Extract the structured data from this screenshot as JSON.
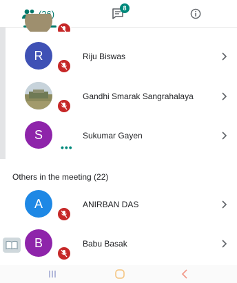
{
  "tabs": {
    "people_count": "(26)",
    "chat_badge": "8"
  },
  "participants": [
    {
      "name": "Riju Biswas",
      "initial": "R",
      "avatar_color": "#3f51b5"
    },
    {
      "name": "Gandhi Smarak Sangrahalaya"
    },
    {
      "name": "Sukumar Gayen",
      "initial": "S",
      "avatar_color": "#8e24aa"
    }
  ],
  "others_section": {
    "label": "Others in the meeting (22)"
  },
  "others": [
    {
      "name": "ANIRBAN DAS",
      "initial": "A",
      "avatar_color": "#1e88e5"
    },
    {
      "name": "Babu Basak",
      "initial": "B",
      "avatar_color": "#8e24aa"
    }
  ],
  "colors": {
    "accent": "#00796b",
    "mic_off": "#c62828"
  }
}
